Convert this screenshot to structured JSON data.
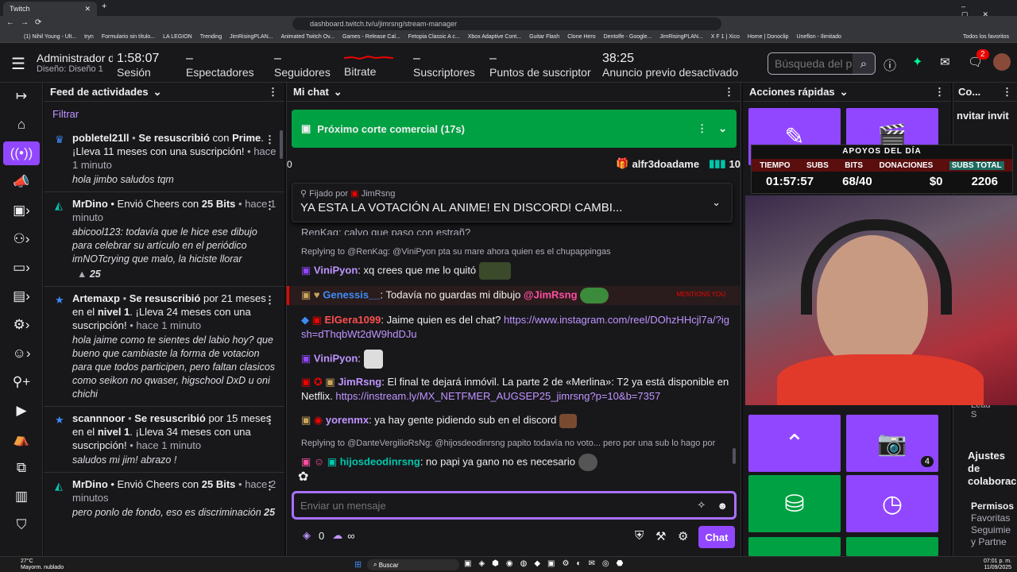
{
  "browser": {
    "tab_title": "Twitch",
    "url": "dashboard.twitch.tv/u/jimrsng/stream-manager",
    "bookmarks": [
      "(1) Nihil Young - Ult...",
      "tryn",
      "Formulario sin título...",
      "LA LEGION",
      "Trending",
      "JimRisingPLAN...",
      "Animated Twitch Ov...",
      "Games - Release Cal...",
      "Fetopia Classic A c...",
      "Xbox Adaptive Cont...",
      "Guitar Flash",
      "Clone Hero",
      "Dentolfe - Google...",
      "JimRisingPLAN...",
      "X F 1 | Xico",
      "Home | Donoclip",
      "Uneflon - Ilimitado",
      "Todos los favoritos"
    ]
  },
  "topbar": {
    "admin_title": "Administrador de",
    "admin_sub": "Diseño: Diseño 1",
    "session_time": "1:58:07",
    "session_label": "Sesión",
    "viewers_value": "–",
    "viewers_label": "Espectadores",
    "followers_value": "–",
    "followers_label": "Seguidores",
    "bitrate_label": "Bitrate",
    "subs_value": "–",
    "subs_label": "Suscriptores",
    "points_value": "–",
    "points_label": "Puntos de suscriptor",
    "ad_time": "38:25",
    "ad_label": "Anuncio previo desactivado",
    "search_placeholder": "Búsqueda del p",
    "notif_count": "2"
  },
  "feed": {
    "title": "Feed de actividades",
    "filter": "Filtrar",
    "items": [
      {
        "user": "pobletel21ll",
        "action": "Se resuscribió",
        "rest": " con ",
        "bold2": "Prime",
        "tail": ". ¡Lleva 11 meses con una suscripción!",
        "time": " • hace 1 minuto",
        "msg": "hola jimbo saludos tqm",
        "extra": ""
      },
      {
        "user": "MrDino",
        "action": "",
        "rest": " • Envió Cheers con ",
        "bold2": "25 Bits",
        "tail": "",
        "time": " • hace 1 minuto",
        "msg": "abicool123: todavía que le hice ese dibujo para celebrar su artículo en el periódico imNOTcrying que malo, la hiciste llorar",
        "extra": "25"
      },
      {
        "user": "Artemaxp",
        "action": "Se resuscribió",
        "rest": " por 21 meses en el ",
        "bold2": "nivel 1",
        "tail": ". ¡Lleva 24 meses con una suscripción!",
        "time": " • hace 1 minuto",
        "msg": "hola jaime como te sientes del labio hoy? que bueno que cambiaste la forma de votacion para que todos participen, pero faltan clasicos como seikon no qwaser, higschool DxD u oni chichi",
        "extra": ""
      },
      {
        "user": "scannnoor",
        "action": "Se resuscribió",
        "rest": " por 15 meses en el ",
        "bold2": "nivel 1",
        "tail": ". ¡Lleva 34 meses con una suscripción!",
        "time": " • hace 1 minuto",
        "msg": "saludos mi jim! abrazo !",
        "extra": ""
      },
      {
        "user": "MrDino",
        "action": "",
        "rest": " • Envió Cheers con ",
        "bold2": "25 Bits",
        "tail": "",
        "time": " • hace 2 minutos",
        "msg": "pero ponlo de fondo, eso es discriminación",
        "extra": "25"
      }
    ]
  },
  "chat": {
    "title": "Mi chat",
    "ad_banner": "Próximo corte comercial (17s)",
    "zero": "0",
    "gift_user": "alfr3doadame",
    "gift_count": "10",
    "pinned_by_label": "Fijado por",
    "pinned_by_user": "JimRsng",
    "pinned_text": "YA ESTA LA VOTACIÓN AL ANIME! EN DISCORD! CAMBI...",
    "partial_top": "RenKag: calvo que paso con estrañ?",
    "reply1": "Replying to @RenKag: @ViniPyon pta su mare ahora quien es el chupappingas",
    "line1_user": "ViniPyon",
    "line1_msg": ": xq crees que me lo quitó",
    "mentions_label": "MENTIONS YOU",
    "line2_user": "Genessis__",
    "line2_msg": ": Todavía no guardas mi dibujo ",
    "line2_mention": "@JimRsng",
    "line3_user": "ElGera1099",
    "line3_msg": ": Jaime quien es del chat? ",
    "line3_link": "https://www.instagram.com/reel/DOhzHHcjl7a/?igsh=dThqbWt2dW9hdDJu",
    "line4_user": "ViniPyon",
    "line4_msg": ":",
    "line5_user": "JimRsng",
    "line5_msg": ": El final te dejará inmóvil. La parte 2 de «Merlina»: T2 ya está disponible en Netflix. ",
    "line5_link": "https://instream.ly/MX_NETFMER_AUGSEP25_jimrsng?p=10&b=7357",
    "line6_user": "yorenmx",
    "line6_msg": ": ya hay gente pidiendo sub en el discord",
    "reply2": "Replying to @DanteVergilioRsNg: @hijosdeodinrsng papito todavía no voto... pero por una sub lo hago por",
    "line7_user": "hijosdeodinrsng",
    "line7_msg": ": no papi ya gano no es necesario",
    "input_placeholder": "Enviar un mensaje",
    "points": "0",
    "infinity": "∞",
    "chat_button": "Chat"
  },
  "quick": {
    "title": "Acciones rápidas",
    "badge": "4"
  },
  "co": {
    "title": "Co...",
    "invite": "nvitar invit",
    "settings1": "Ajustes",
    "settings2": "de",
    "settings3": "colaborac",
    "perm": "Permisos",
    "fav1": "Favoritas",
    "fav2": "Seguimie",
    "fav3": "y Partne",
    "lead": "Lead",
    "s": "S"
  },
  "overlay": {
    "title": "APOYOS DEL DÍA",
    "headers": [
      "TIEMPO",
      "SUBS",
      "BITS",
      "DONACIONES",
      "SUBS TOTAL"
    ],
    "values": [
      "01:57:57",
      "68/40",
      "",
      "$0",
      "2206"
    ]
  },
  "taskbar": {
    "temp": "27°C",
    "weather": "Mayorm. nublado",
    "search": "Buscar",
    "time": "07:01 p. m.",
    "date": "11/09/2025"
  },
  "colors": {
    "accent": "#9147ff",
    "green": "#00a143",
    "bg": "#18181b"
  }
}
